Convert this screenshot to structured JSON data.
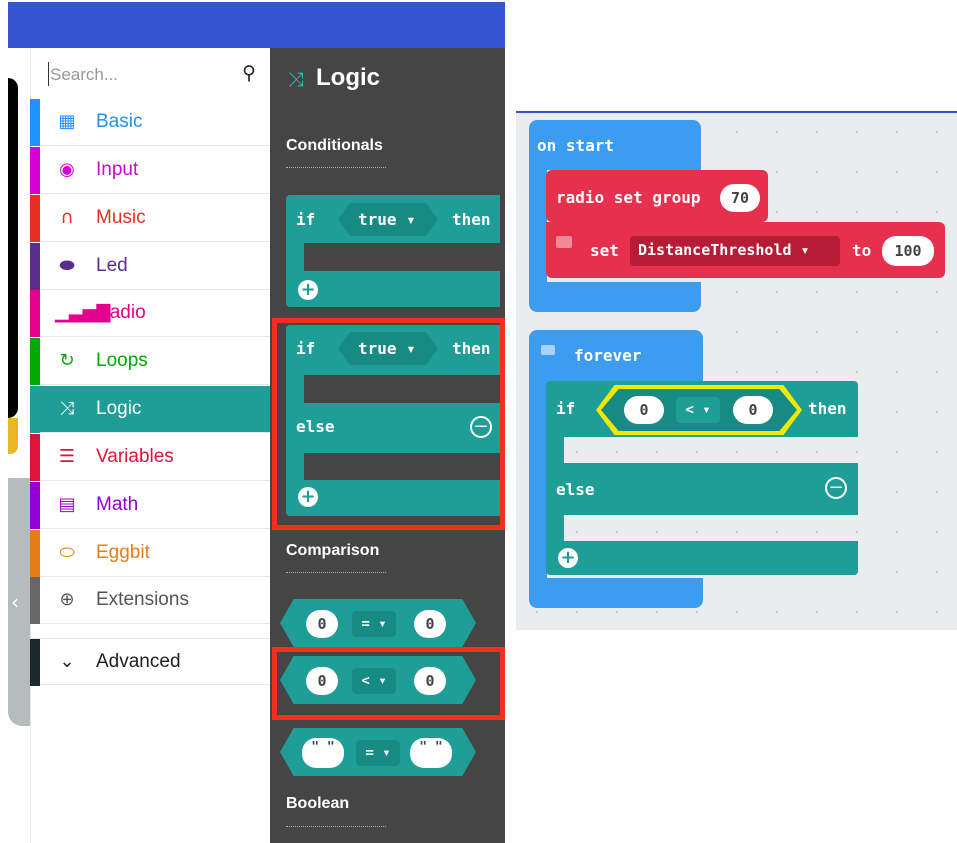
{
  "search": {
    "placeholder": "Search...",
    "icon": "search-icon"
  },
  "categories": [
    {
      "label": "Basic",
      "color": "#1e90ff",
      "icon": "grid-icon"
    },
    {
      "label": "Input",
      "color": "#d400d4",
      "icon": "circle-dot-icon"
    },
    {
      "label": "Music",
      "color": "#e63022",
      "icon": "headphones-icon"
    },
    {
      "label": "Led",
      "color": "#5c2d91",
      "icon": "toggle-icon"
    },
    {
      "label": "Radio",
      "color": "#e3008c",
      "icon": "signal-bars-icon"
    },
    {
      "label": "Loops",
      "color": "#00aa00",
      "icon": "refresh-icon"
    },
    {
      "label": "Logic",
      "color": "#00a4a6",
      "icon": "shuffle-icon"
    },
    {
      "label": "Variables",
      "color": "#dc143c",
      "icon": "lines-icon"
    },
    {
      "label": "Math",
      "color": "#9400d3",
      "icon": "calculator-icon"
    },
    {
      "label": "Eggbit",
      "color": "#e47e19",
      "icon": "gamepad-icon"
    },
    {
      "label": "Extensions",
      "color": "#666666",
      "icon": "plus-circle-icon"
    },
    {
      "label": "Advanced",
      "color": "#222222",
      "icon": "chevron-down-icon"
    }
  ],
  "flyout": {
    "title": "Logic",
    "sections": {
      "conditionals": "Conditionals",
      "comparison": "Comparison",
      "boolean": "Boolean"
    },
    "if1": {
      "if": "if",
      "cond": "true ▾",
      "then": "then"
    },
    "if2": {
      "if": "if",
      "cond": "true ▾",
      "then": "then",
      "else": "else"
    },
    "cmp1": {
      "left": "0",
      "op": "= ▾",
      "right": "0"
    },
    "cmp2": {
      "left": "0",
      "op": "< ▾",
      "right": "0"
    },
    "cmp3": {
      "left": "\" \"",
      "op": "= ▾",
      "right": "\" \""
    }
  },
  "workspace": {
    "on_start": "on start",
    "radio_set_group": "radio set group",
    "group_value": "70",
    "set": "set",
    "variable": "DistanceThreshold ▾",
    "to": "to",
    "set_value": "100",
    "forever": "forever",
    "if": "if",
    "left": "0",
    "op": "< ▾",
    "right": "0",
    "then": "then",
    "else": "else"
  },
  "colors": {
    "logic": "#1f9e97",
    "radio": "#e6304d",
    "basic": "#3c9df0",
    "highlight": "#f3301d",
    "topbar": "#3454d1"
  }
}
